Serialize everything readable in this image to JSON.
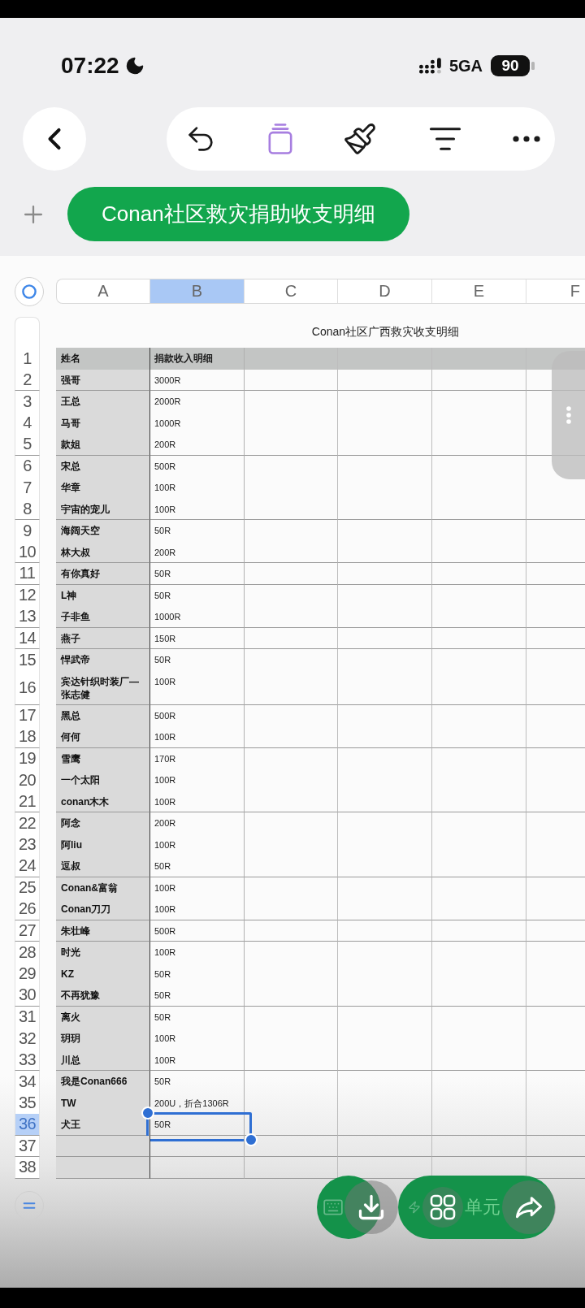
{
  "status_bar": {
    "time": "07:22",
    "network": "5GA",
    "battery": "90"
  },
  "sheet_tab": {
    "label": "Conan社区救灾捐助收支明细",
    "selected": true
  },
  "spreadsheet": {
    "columns": [
      {
        "label": "A",
        "selected": false
      },
      {
        "label": "B",
        "selected": true
      },
      {
        "label": "C",
        "selected": false
      },
      {
        "label": "D",
        "selected": false
      },
      {
        "label": "E",
        "selected": false
      },
      {
        "label": "F",
        "selected": false
      }
    ],
    "title": "Conan社区广西救灾收支明细",
    "row_groups": [
      {
        "rows": [
          {
            "number": "1",
            "kind": "header",
            "name": "姓名",
            "amount": "捐款收入明细",
            "selected": false
          },
          {
            "number": "2",
            "kind": "entry",
            "name": "强哥",
            "amount": "3000R",
            "selected": false
          }
        ]
      },
      {
        "rows": [
          {
            "number": "3",
            "kind": "entry",
            "name": "王总",
            "amount": "2000R",
            "selected": false
          },
          {
            "number": "4",
            "kind": "entry",
            "name": "马哥",
            "amount": "1000R",
            "selected": false
          },
          {
            "number": "5",
            "kind": "entry",
            "name": "款姐",
            "amount": "200R",
            "selected": false
          }
        ]
      },
      {
        "rows": [
          {
            "number": "6",
            "kind": "entry",
            "name": "宋总",
            "amount": "500R",
            "selected": false
          },
          {
            "number": "7",
            "kind": "entry",
            "name": "华章",
            "amount": "100R",
            "selected": false
          },
          {
            "number": "8",
            "kind": "entry",
            "name": "宇宙的宠儿",
            "amount": "100R",
            "selected": false
          }
        ]
      },
      {
        "rows": [
          {
            "number": "9",
            "kind": "entry",
            "name": "海阔天空",
            "amount": "50R",
            "selected": false
          },
          {
            "number": "10",
            "kind": "entry",
            "name": "林大叔",
            "amount": "200R",
            "selected": false
          }
        ]
      },
      {
        "rows": [
          {
            "number": "11",
            "kind": "entry",
            "name": "有你真好",
            "amount": "50R",
            "selected": false
          }
        ]
      },
      {
        "rows": [
          {
            "number": "12",
            "kind": "entry",
            "name": "L神",
            "amount": "50R",
            "selected": false
          },
          {
            "number": "13",
            "kind": "entry",
            "name": "子非鱼",
            "amount": "1000R",
            "selected": false
          }
        ]
      },
      {
        "rows": [
          {
            "number": "14",
            "kind": "entry",
            "name": "燕子",
            "amount": "150R",
            "selected": false
          }
        ]
      },
      {
        "rows": [
          {
            "number": "15",
            "kind": "entry",
            "name": "悍武帝",
            "amount": "50R",
            "selected": false
          },
          {
            "number": "16",
            "kind": "entry",
            "name": "宾达针织时装厂—张志健",
            "amount": "100R",
            "selected": false
          }
        ]
      },
      {
        "rows": [
          {
            "number": "17",
            "kind": "entry",
            "name": "黑总",
            "amount": "500R",
            "selected": false
          },
          {
            "number": "18",
            "kind": "entry",
            "name": "何何",
            "amount": "100R",
            "selected": false
          }
        ]
      },
      {
        "rows": [
          {
            "number": "19",
            "kind": "entry",
            "name": "雪鹰",
            "amount": "170R",
            "selected": false
          },
          {
            "number": "20",
            "kind": "entry",
            "name": "一个太阳",
            "amount": "100R",
            "selected": false
          },
          {
            "number": "21",
            "kind": "entry",
            "name": "conan木木",
            "amount": "100R",
            "selected": false
          }
        ]
      },
      {
        "rows": [
          {
            "number": "22",
            "kind": "entry",
            "name": "阿念",
            "amount": "200R",
            "selected": false
          },
          {
            "number": "23",
            "kind": "entry",
            "name": "阿liu",
            "amount": "100R",
            "selected": false
          },
          {
            "number": "24",
            "kind": "entry",
            "name": "逗叔",
            "amount": "50R",
            "selected": false
          }
        ]
      },
      {
        "rows": [
          {
            "number": "25",
            "kind": "entry",
            "name": "Conan&富翁",
            "amount": "100R",
            "selected": false
          },
          {
            "number": "26",
            "kind": "entry",
            "name": "Conan刀刀",
            "amount": "100R",
            "selected": false
          }
        ]
      },
      {
        "rows": [
          {
            "number": "27",
            "kind": "entry",
            "name": "朱壮峰",
            "amount": "500R",
            "selected": false
          }
        ]
      },
      {
        "rows": [
          {
            "number": "28",
            "kind": "entry",
            "name": "时光",
            "amount": "100R",
            "selected": false
          },
          {
            "number": "29",
            "kind": "entry",
            "name": "KZ",
            "amount": "50R",
            "selected": false
          },
          {
            "number": "30",
            "kind": "entry",
            "name": "不再犹豫",
            "amount": "50R",
            "selected": false
          }
        ]
      },
      {
        "rows": [
          {
            "number": "31",
            "kind": "entry",
            "name": "离火",
            "amount": "50R",
            "selected": false
          },
          {
            "number": "32",
            "kind": "entry",
            "name": "玥玥",
            "amount": "100R",
            "selected": false
          },
          {
            "number": "33",
            "kind": "entry",
            "name": "川总",
            "amount": "100R",
            "selected": false
          }
        ]
      },
      {
        "rows": [
          {
            "number": "34",
            "kind": "entry",
            "name": "我是Conan666",
            "amount": "50R",
            "selected": false
          },
          {
            "number": "35",
            "kind": "entry",
            "name": "TW",
            "amount": "200U，折合1306R",
            "selected": false
          },
          {
            "number": "36",
            "kind": "entry",
            "name": "犬王",
            "amount": "50R",
            "selected": true
          }
        ]
      },
      {
        "rows": [
          {
            "number": "37",
            "kind": "entry",
            "selected": false
          }
        ]
      },
      {
        "rows": [
          {
            "number": "38",
            "kind": "entry",
            "selected": false
          }
        ]
      }
    ]
  },
  "floating_actions": {
    "cells_label": "单元"
  }
}
